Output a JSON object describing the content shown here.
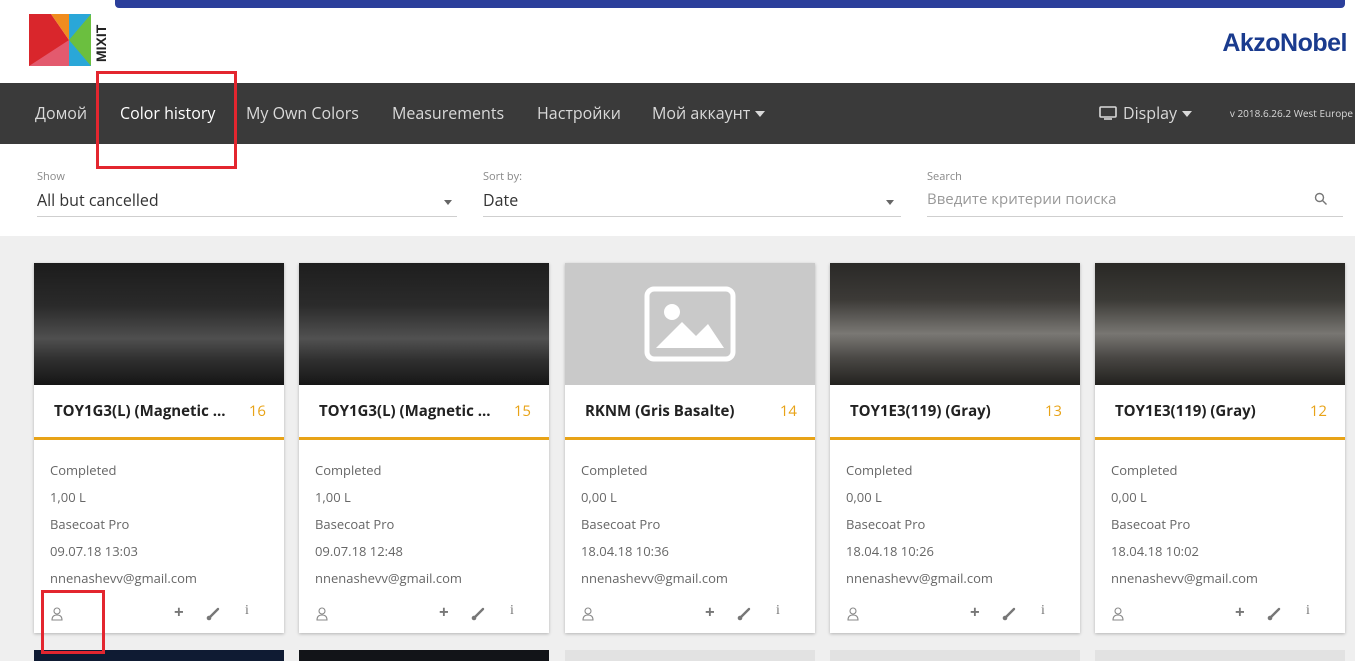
{
  "brand": {
    "logo_text": "MIXIT",
    "company": "AkzoNobel"
  },
  "nav": {
    "items": [
      {
        "label": "Домой"
      },
      {
        "label": "Color history"
      },
      {
        "label": "My Own Colors"
      },
      {
        "label": "Measurements"
      },
      {
        "label": "Настройки"
      },
      {
        "label": "Мой аккаунт"
      }
    ],
    "display_label": "Display",
    "version": "v 2018.6.26.2 West Europe"
  },
  "filters": {
    "show_label": "Show",
    "show_value": "All but cancelled",
    "sort_label": "Sort by:",
    "sort_value": "Date",
    "search_label": "Search",
    "search_placeholder": "Введите критерии поиска"
  },
  "cards": [
    {
      "title": "TOY1G3(L) (Magnetic ...",
      "number": "16",
      "status": "Completed",
      "volume": "1,00 L",
      "product": "Basecoat Pro",
      "datetime": "09.07.18 13:03",
      "email": "nnenashevv@gmail.com"
    },
    {
      "title": "TOY1G3(L) (Magnetic ...",
      "number": "15",
      "status": "Completed",
      "volume": "1,00 L",
      "product": "Basecoat Pro",
      "datetime": "09.07.18 12:48",
      "email": "nnenashevv@gmail.com"
    },
    {
      "title": "RKNM (Gris Basalte)",
      "number": "14",
      "status": "Completed",
      "volume": "0,00 L",
      "product": "Basecoat Pro",
      "datetime": "18.04.18 10:36",
      "email": "nnenashevv@gmail.com"
    },
    {
      "title": "TOY1E3(119) (Gray)",
      "number": "13",
      "status": "Completed",
      "volume": "0,00 L",
      "product": "Basecoat Pro",
      "datetime": "18.04.18 10:26",
      "email": "nnenashevv@gmail.com"
    },
    {
      "title": "TOY1E3(119) (Gray)",
      "number": "12",
      "status": "Completed",
      "volume": "0,00 L",
      "product": "Basecoat Pro",
      "datetime": "18.04.18 10:02",
      "email": "nnenashevv@gmail.com"
    }
  ],
  "icons": {
    "user": "user-icon",
    "plus": "plus-icon",
    "brush": "brush-icon",
    "info": "info-icon",
    "search": "search-icon",
    "monitor": "monitor-icon",
    "image_placeholder": "image-placeholder-icon"
  },
  "colors": {
    "nav_bg": "#3a3a3a",
    "accent": "#e8a317",
    "highlight_box": "#e3262f",
    "brand_blue": "#1a3b8e"
  }
}
